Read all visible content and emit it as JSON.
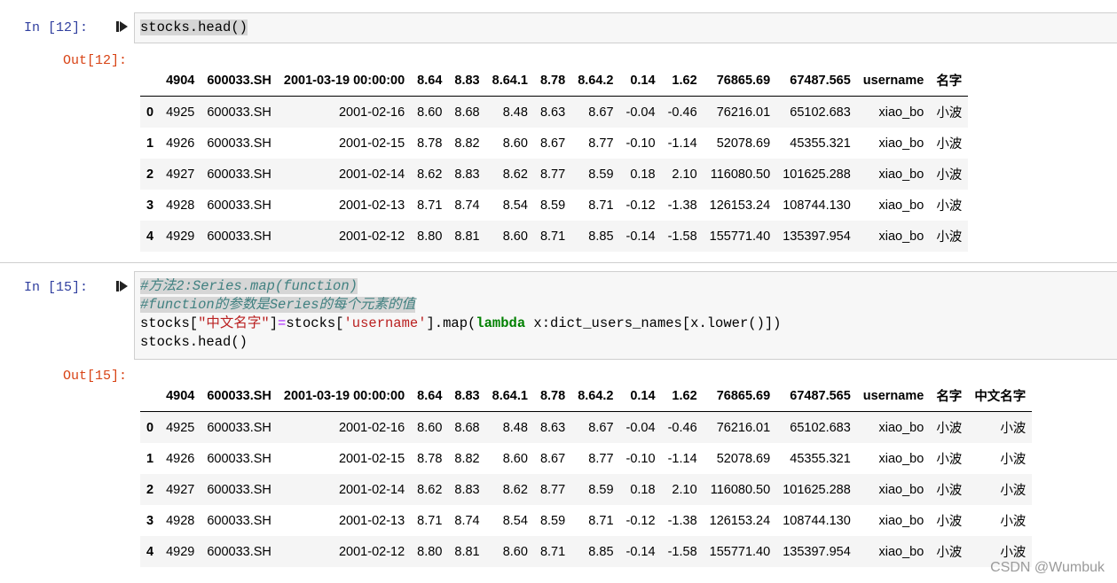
{
  "cells": [
    {
      "in_prompt": "In  [12]:",
      "code_lines": [
        "stocks.head()"
      ],
      "out_prompt": "Out[12]:",
      "table": {
        "columns": [
          "",
          "4904",
          "600033.SH",
          "2001-03-19 00:00:00",
          "8.64",
          "8.83",
          "8.64.1",
          "8.78",
          "8.64.2",
          "0.14",
          "1.62",
          "76865.69",
          "67487.565",
          "username",
          "名字"
        ],
        "rows": [
          [
            "0",
            "4925",
            "600033.SH",
            "2001-02-16",
            "8.60",
            "8.68",
            "8.48",
            "8.63",
            "8.67",
            "-0.04",
            "-0.46",
            "76216.01",
            "65102.683",
            "xiao_bo",
            "小波"
          ],
          [
            "1",
            "4926",
            "600033.SH",
            "2001-02-15",
            "8.78",
            "8.82",
            "8.60",
            "8.67",
            "8.77",
            "-0.10",
            "-1.14",
            "52078.69",
            "45355.321",
            "xiao_bo",
            "小波"
          ],
          [
            "2",
            "4927",
            "600033.SH",
            "2001-02-14",
            "8.62",
            "8.83",
            "8.62",
            "8.77",
            "8.59",
            "0.18",
            "2.10",
            "116080.50",
            "101625.288",
            "xiao_bo",
            "小波"
          ],
          [
            "3",
            "4928",
            "600033.SH",
            "2001-02-13",
            "8.71",
            "8.74",
            "8.54",
            "8.59",
            "8.71",
            "-0.12",
            "-1.38",
            "126153.24",
            "108744.130",
            "xiao_bo",
            "小波"
          ],
          [
            "4",
            "4929",
            "600033.SH",
            "2001-02-12",
            "8.80",
            "8.81",
            "8.60",
            "8.71",
            "8.85",
            "-0.14",
            "-1.58",
            "155771.40",
            "135397.954",
            "xiao_bo",
            "小波"
          ]
        ]
      }
    },
    {
      "in_prompt": "In  [15]:",
      "code": {
        "comment1": "#方法2:Series.map(function)",
        "comment2": "#function的参数是Series的每个元素的值",
        "line3_a": "stocks[",
        "line3_str1": "\"中文名字\"",
        "line3_b": "]",
        "line3_eq": "=",
        "line3_c": "stocks[",
        "line3_str2": "'username'",
        "line3_d": "].map(",
        "line3_kw": "lambda",
        "line3_e": " x:dict_users_names[x.lower()])",
        "line4": "stocks.head()"
      },
      "out_prompt": "Out[15]:",
      "table": {
        "columns": [
          "",
          "4904",
          "600033.SH",
          "2001-03-19 00:00:00",
          "8.64",
          "8.83",
          "8.64.1",
          "8.78",
          "8.64.2",
          "0.14",
          "1.62",
          "76865.69",
          "67487.565",
          "username",
          "名字",
          "中文名字"
        ],
        "rows": [
          [
            "0",
            "4925",
            "600033.SH",
            "2001-02-16",
            "8.60",
            "8.68",
            "8.48",
            "8.63",
            "8.67",
            "-0.04",
            "-0.46",
            "76216.01",
            "65102.683",
            "xiao_bo",
            "小波",
            "小波"
          ],
          [
            "1",
            "4926",
            "600033.SH",
            "2001-02-15",
            "8.78",
            "8.82",
            "8.60",
            "8.67",
            "8.77",
            "-0.10",
            "-1.14",
            "52078.69",
            "45355.321",
            "xiao_bo",
            "小波",
            "小波"
          ],
          [
            "2",
            "4927",
            "600033.SH",
            "2001-02-14",
            "8.62",
            "8.83",
            "8.62",
            "8.77",
            "8.59",
            "0.18",
            "2.10",
            "116080.50",
            "101625.288",
            "xiao_bo",
            "小波",
            "小波"
          ],
          [
            "3",
            "4928",
            "600033.SH",
            "2001-02-13",
            "8.71",
            "8.74",
            "8.54",
            "8.59",
            "8.71",
            "-0.12",
            "-1.38",
            "126153.24",
            "108744.130",
            "xiao_bo",
            "小波",
            "小波"
          ],
          [
            "4",
            "4929",
            "600033.SH",
            "2001-02-12",
            "8.80",
            "8.81",
            "8.60",
            "8.71",
            "8.85",
            "-0.14",
            "-1.58",
            "155771.40",
            "135397.954",
            "xiao_bo",
            "小波",
            "小波"
          ]
        ]
      }
    }
  ],
  "watermark": "CSDN @Wumbuk",
  "icons": {
    "run": "run-cell-icon"
  }
}
